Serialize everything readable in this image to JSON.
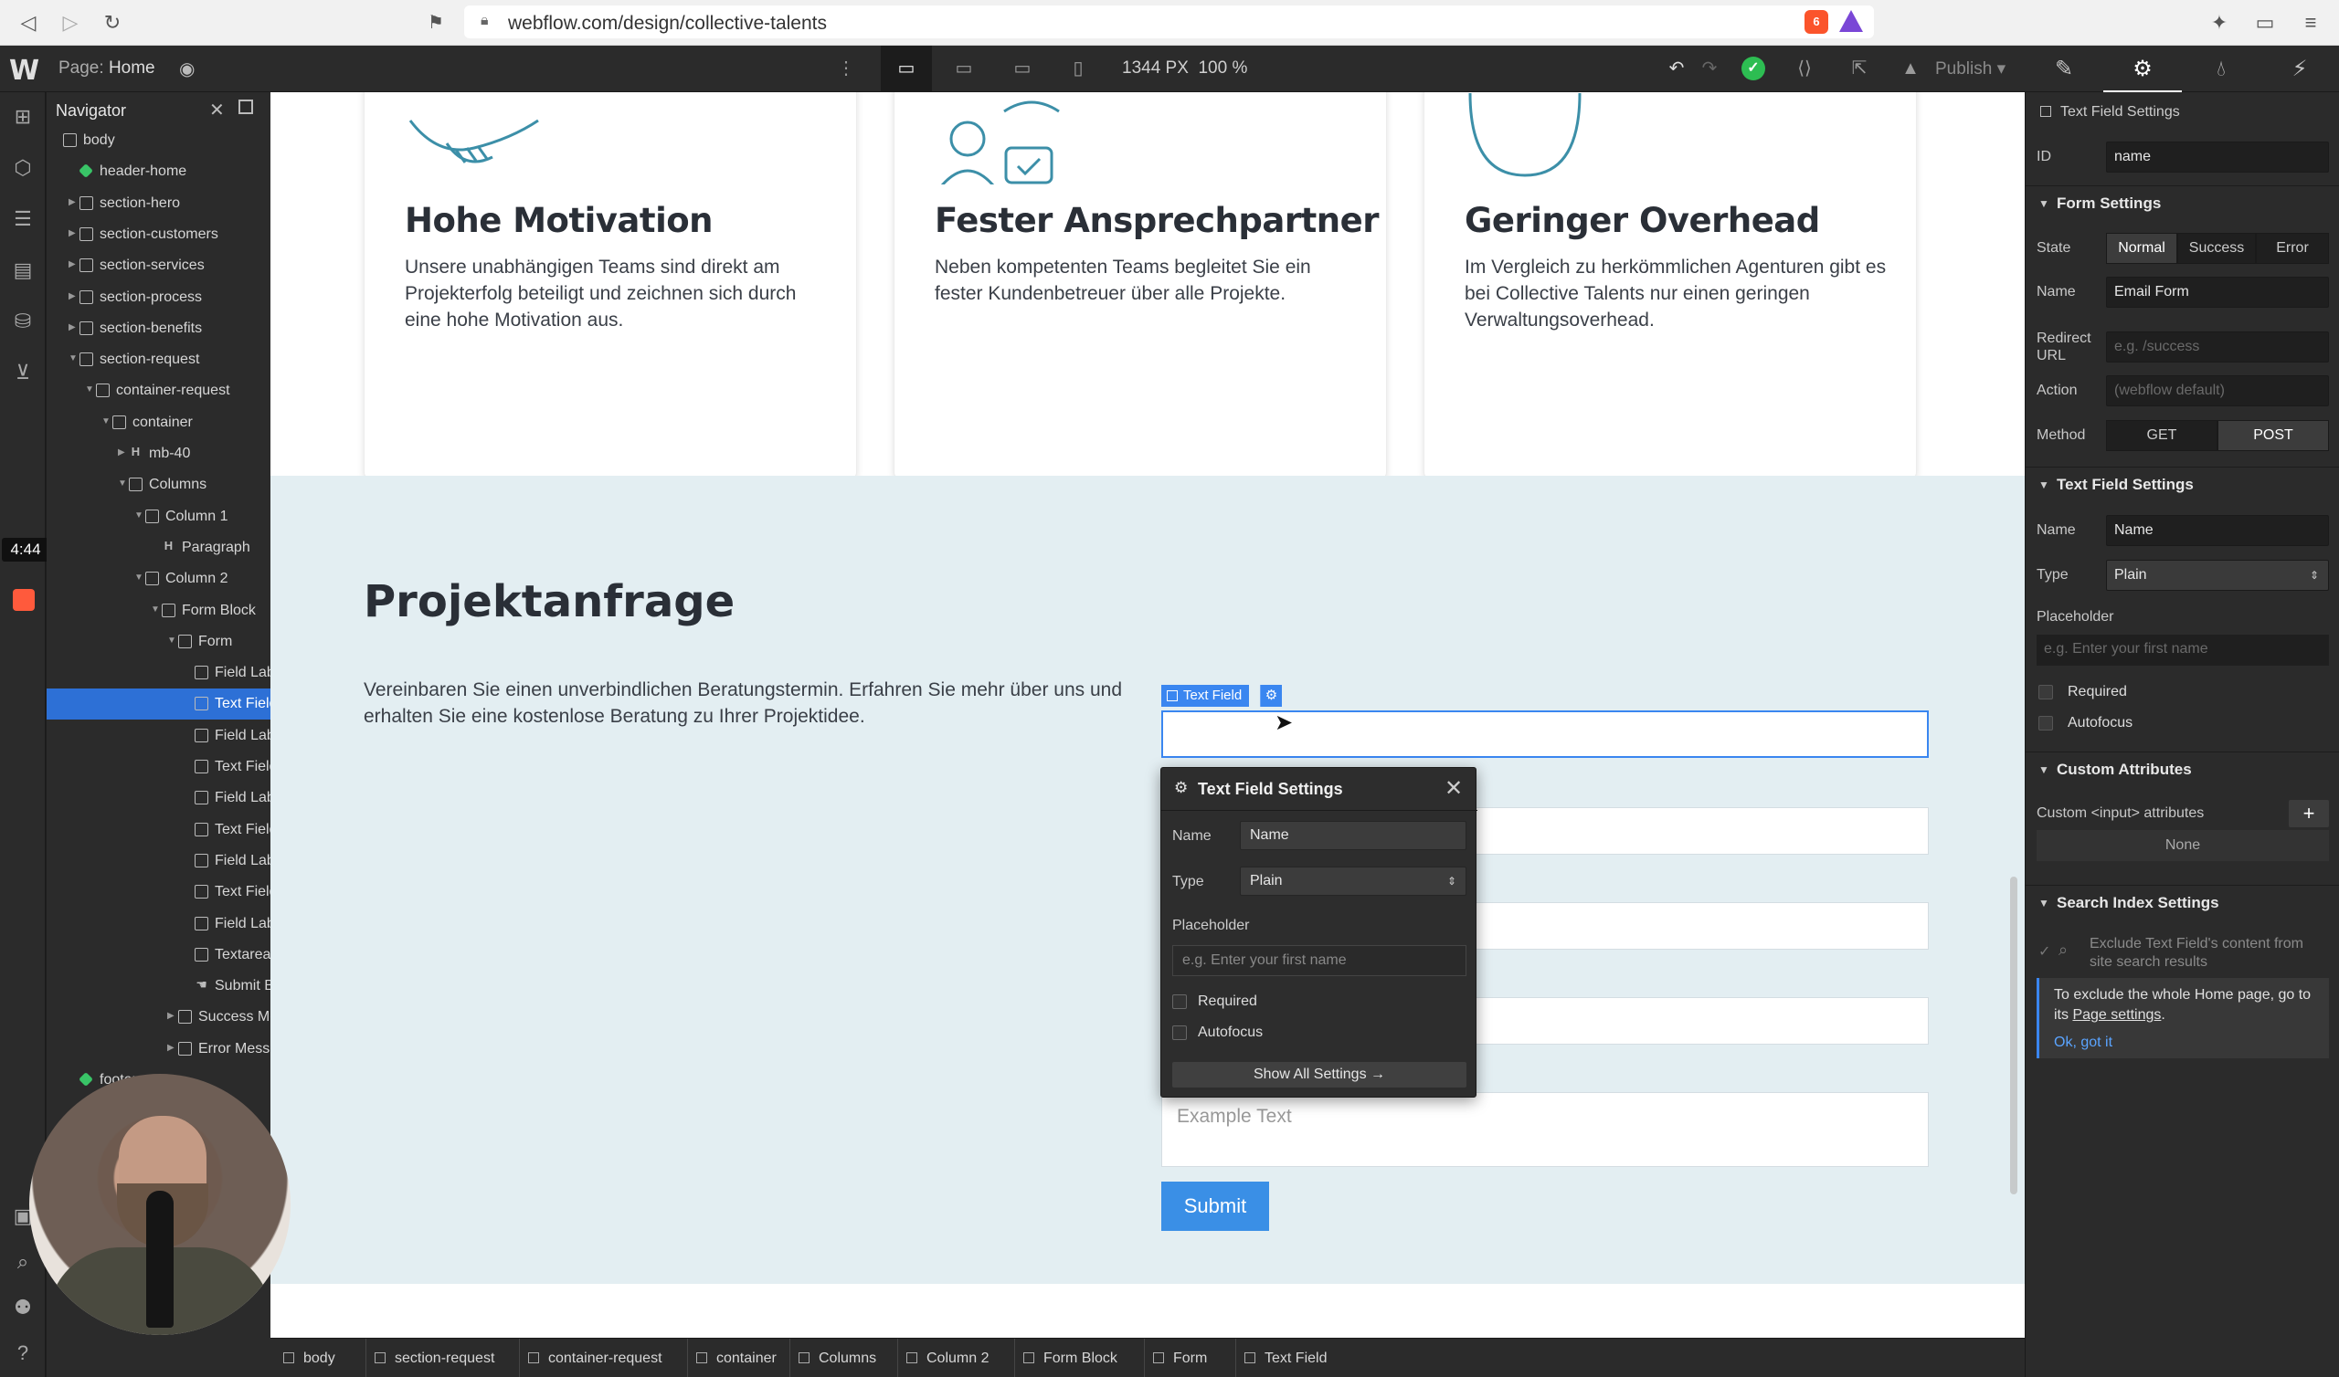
{
  "browser": {
    "url": "webflow.com/design/collective-talents",
    "ext_badge": "6"
  },
  "topbar": {
    "logo": "W",
    "page_prefix": "Page:",
    "page_name": "Home",
    "width_readout": "1344 PX",
    "zoom_readout": "100 %",
    "publish_label": "Publish"
  },
  "timer": "4:44",
  "navigator": {
    "title": "Navigator",
    "items": [
      {
        "label": "body"
      },
      {
        "label": "header-home"
      },
      {
        "label": "section-hero"
      },
      {
        "label": "section-customers"
      },
      {
        "label": "section-services"
      },
      {
        "label": "section-process"
      },
      {
        "label": "section-benefits"
      },
      {
        "label": "section-request"
      },
      {
        "label": "container-request"
      },
      {
        "label": "container"
      },
      {
        "label": "mb-40"
      },
      {
        "label": "Columns"
      },
      {
        "label": "Column 1"
      },
      {
        "label": "Paragraph"
      },
      {
        "label": "Column 2"
      },
      {
        "label": "Form Block"
      },
      {
        "label": "Form"
      },
      {
        "label": "Field Label"
      },
      {
        "label": "Text Field"
      },
      {
        "label": "Field Label"
      },
      {
        "label": "Text Field"
      },
      {
        "label": "Field Label"
      },
      {
        "label": "Text Field"
      },
      {
        "label": "Field Label"
      },
      {
        "label": "Text Field"
      },
      {
        "label": "Field Label"
      },
      {
        "label": "Textarea"
      },
      {
        "label": "Submit Button"
      },
      {
        "label": "Success Message"
      },
      {
        "label": "Error Message"
      },
      {
        "label": "footer"
      }
    ]
  },
  "cards": [
    {
      "title": "Hohe Motivation",
      "text": "Unsere unabhängigen Teams sind direkt am Projekterfolg beteiligt und zeichnen sich durch eine hohe Motivation aus."
    },
    {
      "title": "Fester Ansprechpartner",
      "text": "Neben kompetenten Teams begleitet Sie ein fester Kundenbetreuer über alle Projekte."
    },
    {
      "title": "Geringer Overhead",
      "text": "Im Vergleich zu herkömmlichen Agenturen gibt es bei Collective Talents nur einen geringen Verwaltungsoverhead."
    }
  ],
  "request": {
    "title": "Projektanfrage",
    "text": "Vereinbaren Sie einen unverbindlichen Beratungstermin. Erfahren Sie mehr über uns und erhalten Sie eine kostenlose Beratung zu Ihrer Projektidee.",
    "selected_tag": "Text Field",
    "textarea_placeholder": "Example Text",
    "submit_label": "Submit"
  },
  "popup": {
    "title": "Text Field Settings",
    "name_label": "Name",
    "name_value": "Name",
    "type_label": "Type",
    "type_value": "Plain",
    "placeholder_label": "Placeholder",
    "placeholder_hint": "e.g. Enter your first name",
    "required_label": "Required",
    "autofocus_label": "Autofocus",
    "show_all": "Show All Settings →"
  },
  "breadcrumb": [
    "body",
    "section-request",
    "container-request",
    "container",
    "Columns",
    "Column 2",
    "Form Block",
    "Form",
    "Text Field"
  ],
  "right_panel": {
    "selected": "Text Field Settings",
    "id_label": "ID",
    "id_value": "name",
    "form_settings": {
      "title": "Form Settings",
      "state_label": "State",
      "states": [
        "Normal",
        "Success",
        "Error"
      ],
      "name_label": "Name",
      "name_value": "Email Form",
      "redirect_label": "Redirect URL",
      "redirect_placeholder": "e.g. /success",
      "action_label": "Action",
      "action_placeholder": "(webflow default)",
      "method_label": "Method",
      "methods": [
        "GET",
        "POST"
      ]
    },
    "text_field_settings": {
      "title": "Text Field Settings",
      "name_label": "Name",
      "name_value": "Name",
      "type_label": "Type",
      "type_value": "Plain",
      "placeholder_label": "Placeholder",
      "placeholder_hint": "e.g. Enter your first name",
      "required_label": "Required",
      "autofocus_label": "Autofocus"
    },
    "custom_attributes": {
      "title": "Custom Attributes",
      "label": "Custom <input> attributes",
      "none": "None"
    },
    "search_index": {
      "title": "Search Index Settings",
      "exclude_text": "Exclude Text Field's content from site search results",
      "info_before": "To exclude the whole Home page, go to its ",
      "info_link": "Page settings",
      "info_after": ".",
      "ok": "Ok, got it"
    }
  }
}
